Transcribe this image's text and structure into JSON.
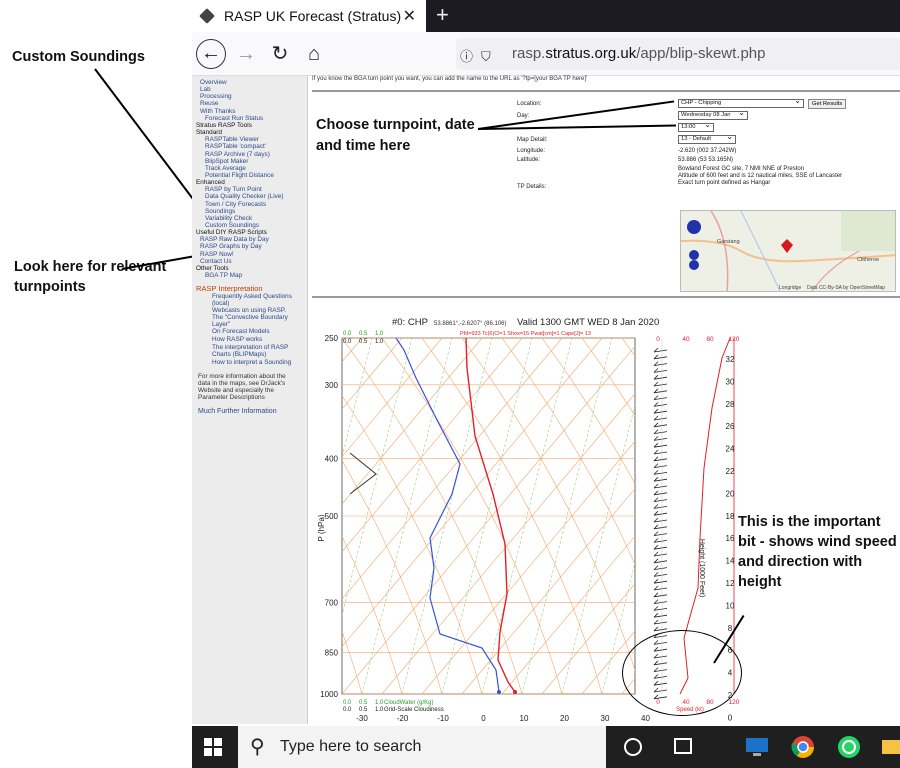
{
  "browser": {
    "tab_title": "RASP UK Forecast (Stratus)",
    "close": "✕",
    "new_tab": "+",
    "url_domain": "rasp.",
    "url_host": "stratus.org.uk",
    "url_path": "/app/blip-skewt.php"
  },
  "annotations": {
    "custom": "Custom Soundings",
    "turnpoints": "Look here for relevant turnpoints",
    "choose": "Choose turnpoint, date and time here",
    "important": "This is the important bit - shows wind speed and direction with height"
  },
  "sidebar": {
    "items": [
      "Overview",
      "Lab",
      "Processing",
      "Reuse",
      "With Thanks",
      "Forecast Run Status",
      "Stratus RASP Tools",
      "Standard",
      "RASPTable Viewer",
      "RASPTable 'compact'",
      "RASP Archive (7 days)",
      "BlipSpot Maker",
      "Track Average",
      "Potential Flight Distance",
      "Enhanced",
      "RASP by Turn Point",
      "Data Quality Checker (Live)",
      "Town / City Forecasts",
      "Soundings",
      "Variability Check",
      "Custom Soundings",
      "Useful DIY RASP Scripts",
      "RASP Raw Data by Day",
      "RASP Graphs by Day",
      "RASP Now!",
      "Contact Us",
      "Other Tools",
      "BGA TP Map"
    ],
    "interp_title": "RASP Interpretation",
    "interp": [
      "Frequently Asked Questions (local)",
      "Webcasts on using RASP.",
      "The \"Convective Boundary Layer\"",
      "On Forecast Models",
      "How RASP works",
      "The interpretation of RASP Charts (BLIPMaps)",
      "How to interpret a Sounding"
    ],
    "more_info": "For more information about the data in the maps, see DrJack's Website and especially the Parameter Descriptions",
    "further": "Much Further Information"
  },
  "form": {
    "hint": "If you know the BGA turn point you want, you can add the name to the URL as '?tp=[your BGA TP here]'",
    "location_label": "Location:",
    "location_value": "CHP - Chipping",
    "get_results": "Get Results",
    "day_label": "Day:",
    "day_value": "Wednesday 08 Jan",
    "time_value": "13:00",
    "map_label": "Map Detail:",
    "map_value": "13 - Default",
    "longitude_label": "Longitude:",
    "longitude_value": "-2.620 (002 37.242W)",
    "latitude_label": "Latitude:",
    "latitude_value": "53.886 (53 53.165N)",
    "tp_label": "TP Details:",
    "tp_details": [
      "Bowland Forest GC site, 7 NMI NNE of Preston",
      "Altitude of 600 feet and is 12 nautical miles, SSE of Lancaster",
      "Exact turn point defined as Hangar"
    ],
    "map_places": [
      "Garstang",
      "Clitheroe",
      "Longridge"
    ],
    "map_credit": "Data CC-By-SA by OpenStreetMap"
  },
  "chart": {
    "title_left": "#0: CHP",
    "title_coords": "53.8861°,-2.6207° (86.106)",
    "title_valid": "Valid 1300 GMT WED 8 Jan 2020",
    "subtitle": "Pfd=933 Tc(6)Cl=1 Shox=15 Pwat[cm]=1 Cape[J]= 13",
    "pressure_label": "P (hPa)",
    "height_label": "Height (1000 Feet)",
    "speed_label": "Speed (kt)",
    "cloud_label": "CloudWater (g/Kg)",
    "grid_cloud": "Grid-Scale Cloudiness",
    "p_ticks": [
      "250",
      "300",
      "400",
      "500",
      "700",
      "850",
      "1000"
    ],
    "t_ticks": [
      "-30",
      "-20",
      "-10",
      "0",
      "10",
      "20",
      "30",
      "40"
    ],
    "h_ticks": [
      "32",
      "30",
      "28",
      "26",
      "24",
      "22",
      "20",
      "18",
      "16",
      "14",
      "12",
      "10",
      "8",
      "6",
      "4",
      "2",
      "0"
    ],
    "speed_ticks": [
      "0",
      "40",
      "80",
      "120"
    ],
    "top_cw_ticks": [
      "0.0",
      "0.5",
      "1.0"
    ],
    "top_gs_ticks": [
      "0.0",
      "0.5",
      "1.0"
    ],
    "bot_cw_ticks": [
      "0.0",
      "0.5",
      "1.0"
    ],
    "bot_gs_ticks": [
      "0.0",
      "0.5",
      "1.0"
    ]
  },
  "taskbar": {
    "search_placeholder": "Type here to search"
  },
  "colors": {
    "temp": "#e0202a",
    "dew": "#3355dd",
    "grid": "#f5a76b",
    "adiabat": "#8bbf6b",
    "wind": "#222222"
  }
}
